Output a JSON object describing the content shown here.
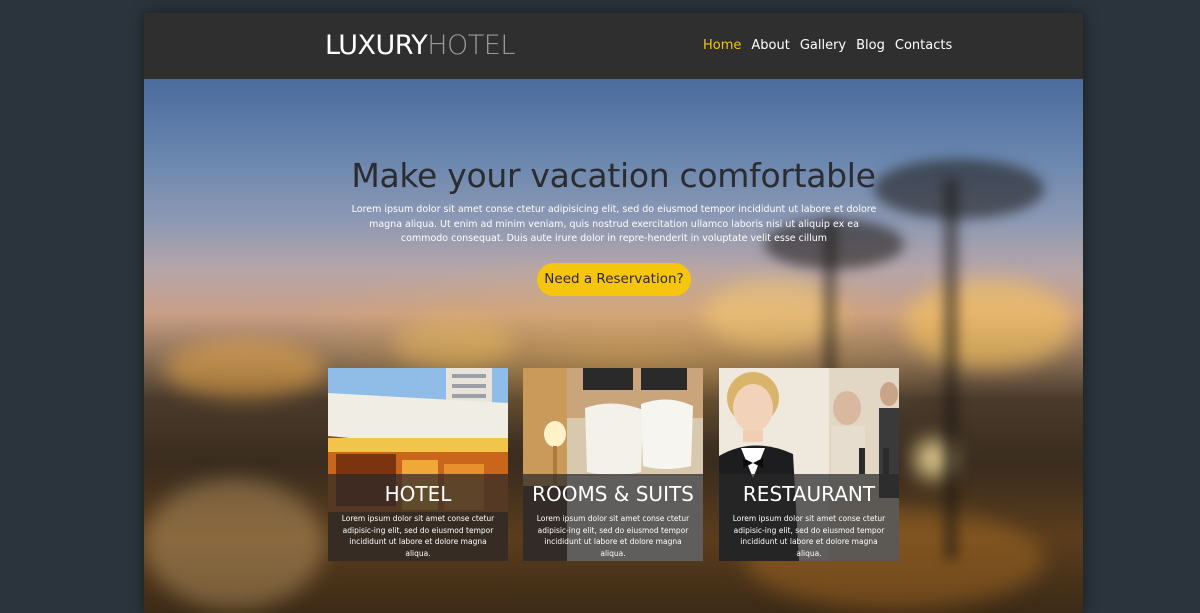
{
  "header": {
    "logo": {
      "part1": "LUXURY",
      "part2": "HOTEL"
    },
    "nav": [
      {
        "label": "Home",
        "active": true
      },
      {
        "label": "About",
        "active": false
      },
      {
        "label": "Gallery",
        "active": false
      },
      {
        "label": "Blog",
        "active": false
      },
      {
        "label": "Contacts",
        "active": false
      }
    ]
  },
  "hero": {
    "title": "Make your vacation comfortable",
    "text": "Lorem ipsum dolor sit amet conse ctetur adipisicing elit, sed do eiusmod tempor incididunt ut labore et dolore magna aliqua. Ut enim ad minim veniam, quis nostrud exercitation ullamco laboris nisi ut aliquip ex ea commodo consequat. Duis aute irure dolor in repre-henderit in voluptate velit esse cillum",
    "cta": "Need a Reservation?"
  },
  "cards": [
    {
      "title": "HOTEL",
      "text": "Lorem ipsum dolor sit amet conse ctetur adipisic-ing elit, sed do eiusmod tempor incididunt ut labore et dolore magna aliqua."
    },
    {
      "title": "ROOMS & SUITS",
      "text": "Lorem ipsum dolor sit amet conse ctetur adipisic-ing elit, sed do eiusmod tempor incididunt ut labore et dolore magna aliqua."
    },
    {
      "title": "RESTAURANT",
      "text": "Lorem ipsum dolor sit amet conse ctetur adipisic-ing elit, sed do eiusmod tempor incididunt ut labore et dolore magna aliqua."
    }
  ],
  "colors": {
    "accent": "#f0c419",
    "button": "#f6c60f",
    "header_bg": "#2f2f2f",
    "page_bg": "#2b343c"
  }
}
